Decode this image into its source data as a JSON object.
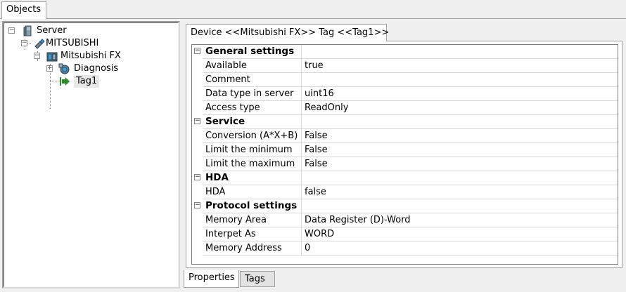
{
  "top_tab": {
    "label": "Objects"
  },
  "tree": {
    "items": [
      {
        "label": "Server",
        "icon": "server-icon",
        "expander": "−"
      },
      {
        "label": "MITSUBISHI",
        "icon": "driver-icon",
        "expander": "−"
      },
      {
        "label": "Mitsubishi FX",
        "icon": "device-icon",
        "expander": "−"
      },
      {
        "label": "Diagnosis",
        "icon": "diagnosis-icon",
        "expander": "+"
      },
      {
        "label": "Tag1",
        "icon": "tag-arrow-icon",
        "expander": ""
      }
    ]
  },
  "panel": {
    "tab_title": "Device <<Mitsubishi FX>> Tag <<Tag1>>",
    "categories": [
      {
        "name": "General settings",
        "toggle": "−",
        "rows": [
          {
            "name": "Available",
            "value": "true"
          },
          {
            "name": "Comment",
            "value": ""
          },
          {
            "name": "Data type in server",
            "value": "uint16"
          },
          {
            "name": "Access type",
            "value": "ReadOnly"
          }
        ]
      },
      {
        "name": "Service",
        "toggle": "−",
        "rows": [
          {
            "name": "Conversion (A*X+B)",
            "value": "False"
          },
          {
            "name": "Limit the minimum",
            "value": "False"
          },
          {
            "name": "Limit the maximum",
            "value": "False"
          }
        ]
      },
      {
        "name": "HDA",
        "toggle": "−",
        "rows": [
          {
            "name": "HDA",
            "value": "false"
          }
        ]
      },
      {
        "name": "Protocol settings",
        "toggle": "−",
        "rows": [
          {
            "name": "Memory Area",
            "value": "Data Register (D)-Word"
          },
          {
            "name": "Interpet As",
            "value": "WORD"
          },
          {
            "name": "Memory Address",
            "value": "0"
          }
        ]
      }
    ],
    "bottom_tabs": [
      {
        "label": "Properties",
        "active": true
      },
      {
        "label": "Tags",
        "active": false
      }
    ]
  },
  "colors": {
    "tag_arrow": "#2e8b2e",
    "border": "#a0a0a0",
    "selection": "#e8e8e8"
  }
}
